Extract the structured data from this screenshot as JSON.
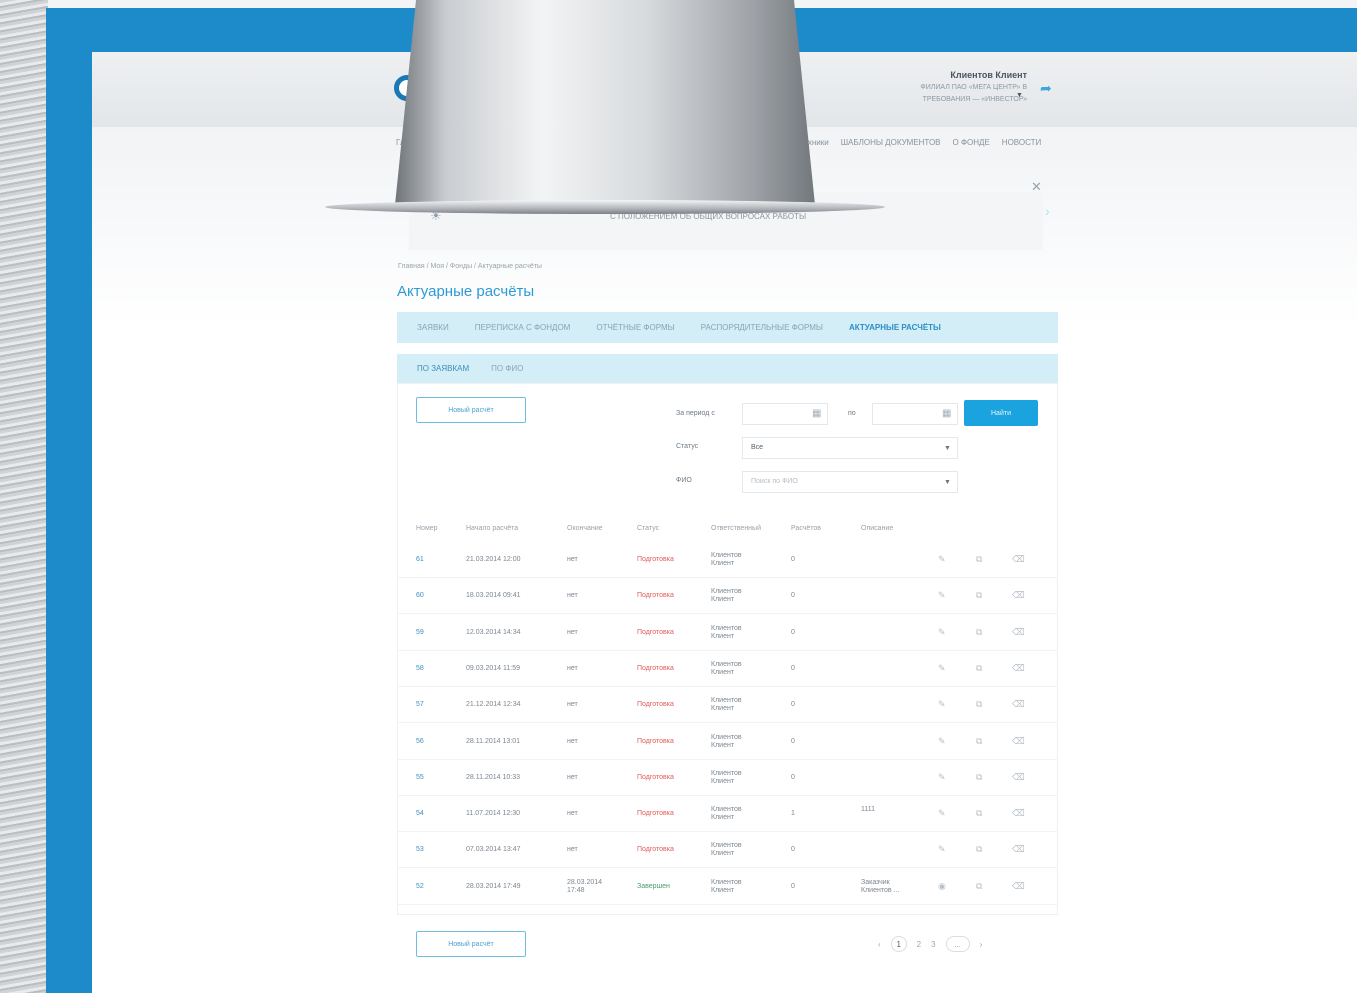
{
  "header": {
    "user_name": "Клиентов Клиент",
    "user_org_line1": "ФИЛИАЛ ПАО «МЕГА ЦЕНТР» В",
    "user_org_line2": "ТРЕБОВАНИЯ — «ИНВЕСТОР»",
    "logout_icon": "logout-icon",
    "nav_left": "Гл",
    "top_nav": [
      "техники",
      "ШАБЛОНЫ ДОКУМЕНТОВ",
      "О ФОНДЕ",
      "НОВОСТИ"
    ],
    "banner_text": "С ПОЛОЖЕНИЕМ ОБ ОБЩИХ ВОПРОСАХ РАБОТЫ"
  },
  "breadcrumb": "Главная / Моя / Фонды / Актуарные расчёты",
  "page_title": "Актуарные расчёты",
  "tabs": [
    {
      "label": "ЗАЯВКИ",
      "active": false
    },
    {
      "label": "ПЕРЕПИСКА С ФОНДОМ",
      "active": false
    },
    {
      "label": "ОТЧЁТНЫЕ ФОРМЫ",
      "active": false
    },
    {
      "label": "РАСПОРЯДИТЕЛЬНЫЕ ФОРМЫ",
      "active": false
    },
    {
      "label": "АКТУАРНЫЕ РАСЧЁТЫ",
      "active": true
    }
  ],
  "subtabs": [
    {
      "label": "ПО ЗАЯВКАМ",
      "active": true
    },
    {
      "label": "ПО ФИО",
      "active": false
    }
  ],
  "new_calc_button": "Новый расчёт",
  "filters": {
    "period_label": "За период с",
    "to_label": "по",
    "find_button": "Найти",
    "status_label": "Статус",
    "status_value": "Все",
    "fio_label": "ФИО",
    "fio_placeholder": "Поиск по ФИО"
  },
  "columns": [
    "Номер",
    "Начало расчёта",
    "Окончание",
    "Статус",
    "Ответственный",
    "Расчётов",
    "Описание"
  ],
  "rows": [
    {
      "num": "61",
      "start": "21.03.2014 12:00",
      "end": "нет",
      "status": "Подготовка",
      "status_type": "red",
      "resp": "Клиентов Клиент",
      "count": "0",
      "desc": "",
      "edit_icon": "pencil-icon"
    },
    {
      "num": "60",
      "start": "18.03.2014 09:41",
      "end": "нет",
      "status": "Подготовка",
      "status_type": "red",
      "resp": "Клиентов Клиент",
      "count": "0",
      "desc": "",
      "edit_icon": "pencil-icon"
    },
    {
      "num": "59",
      "start": "12.03.2014 14:34",
      "end": "нет",
      "status": "Подготовка",
      "status_type": "red",
      "resp": "Клиентов Клиент",
      "count": "0",
      "desc": "",
      "edit_icon": "pencil-icon"
    },
    {
      "num": "58",
      "start": "09.03.2014 11:59",
      "end": "нет",
      "status": "Подготовка",
      "status_type": "red",
      "resp": "Клиентов Клиент",
      "count": "0",
      "desc": "",
      "edit_icon": "pencil-icon"
    },
    {
      "num": "57",
      "start": "21.12.2014 12:34",
      "end": "нет",
      "status": "Подготовка",
      "status_type": "red",
      "resp": "Клиентов Клиент",
      "count": "0",
      "desc": "",
      "edit_icon": "pencil-icon"
    },
    {
      "num": "56",
      "start": "28.11.2014 13:01",
      "end": "нет",
      "status": "Подготовка",
      "status_type": "red",
      "resp": "Клиентов Клиент",
      "count": "0",
      "desc": "",
      "edit_icon": "pencil-icon"
    },
    {
      "num": "55",
      "start": "28.11.2014 10:33",
      "end": "нет",
      "status": "Подготовка",
      "status_type": "red",
      "resp": "Клиентов Клиент",
      "count": "0",
      "desc": "",
      "edit_icon": "pencil-icon"
    },
    {
      "num": "54",
      "start": "11.07.2014 12:30",
      "end": "нет",
      "status": "Подготовка",
      "status_type": "red",
      "resp": "Клиентов Клиент",
      "count": "1",
      "desc": "1111",
      "edit_icon": "pencil-icon"
    },
    {
      "num": "53",
      "start": "07.03.2014 13:47",
      "end": "нет",
      "status": "Подготовка",
      "status_type": "red",
      "resp": "Клиентов Клиент",
      "count": "0",
      "desc": "",
      "edit_icon": "pencil-icon"
    },
    {
      "num": "52",
      "start": "28.03.2014 17:49",
      "end": "28.03.2014 17:48",
      "status": "Завершен",
      "status_type": "green",
      "resp": "Клиентов Клиент",
      "count": "0",
      "desc": "Заказчик Клиентов ...",
      "edit_icon": "eye-icon"
    }
  ],
  "pagination": {
    "prev": "‹",
    "pages": [
      "1",
      "2",
      "3"
    ],
    "ellipsis": "...",
    "next": "›"
  },
  "colors": {
    "frame_blue": "#1d8ac9",
    "accent": "#2d9ad6",
    "tab_bg": "#d4eef8",
    "status_red": "#e35a5a",
    "status_green": "#4a9d6e"
  }
}
